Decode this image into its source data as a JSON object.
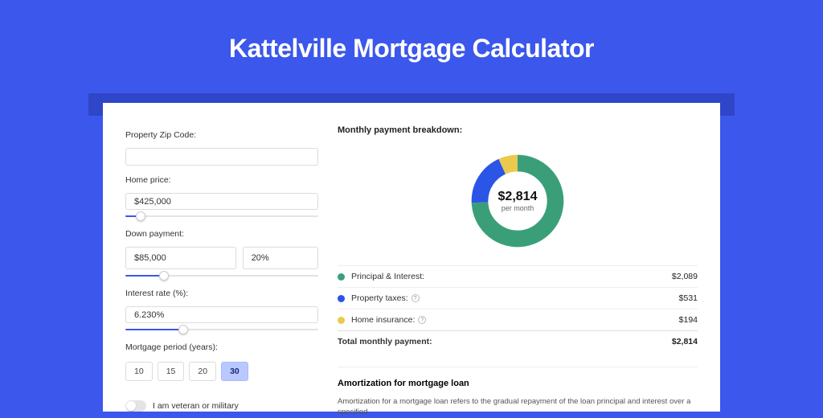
{
  "page_title": "Kattelville Mortgage Calculator",
  "form": {
    "zip_label": "Property Zip Code:",
    "zip_value": "",
    "price_label": "Home price:",
    "price_value": "$425,000",
    "price_slider_pct": 8,
    "dp_label": "Down payment:",
    "dp_value": "$85,000",
    "dp_pct": "20%",
    "dp_slider_pct": 20,
    "rate_label": "Interest rate (%):",
    "rate_value": "6.230%",
    "rate_slider_pct": 30,
    "period_label": "Mortgage period (years):",
    "periods": [
      "10",
      "15",
      "20",
      "30"
    ],
    "period_selected": "30",
    "veteran_label": "I am veteran or military",
    "veteran_on": false
  },
  "breakdown": {
    "title": "Monthly payment breakdown:",
    "center_amount": "$2,814",
    "center_sub": "per month",
    "items": [
      {
        "label": "Principal & Interest:",
        "value": "$2,089",
        "amount": 2089,
        "color": "#3a9f78",
        "info": false
      },
      {
        "label": "Property taxes:",
        "value": "$531",
        "amount": 531,
        "color": "#2a55e6",
        "info": true
      },
      {
        "label": "Home insurance:",
        "value": "$194",
        "amount": 194,
        "color": "#eac94c",
        "info": true
      }
    ],
    "total_label": "Total monthly payment:",
    "total_value": "$2,814",
    "total_amount": 2814
  },
  "amortization": {
    "title": "Amortization for mortgage loan",
    "text": "Amortization for a mortgage loan refers to the gradual repayment of the loan principal and interest over a specified"
  },
  "chart_data": {
    "type": "pie",
    "title": "Monthly payment breakdown",
    "series": [
      {
        "name": "Principal & Interest",
        "value": 2089,
        "color": "#3a9f78"
      },
      {
        "name": "Property taxes",
        "value": 531,
        "color": "#2a55e6"
      },
      {
        "name": "Home insurance",
        "value": 194,
        "color": "#eac94c"
      }
    ],
    "total": 2814,
    "center_label": "$2,814 per month"
  }
}
